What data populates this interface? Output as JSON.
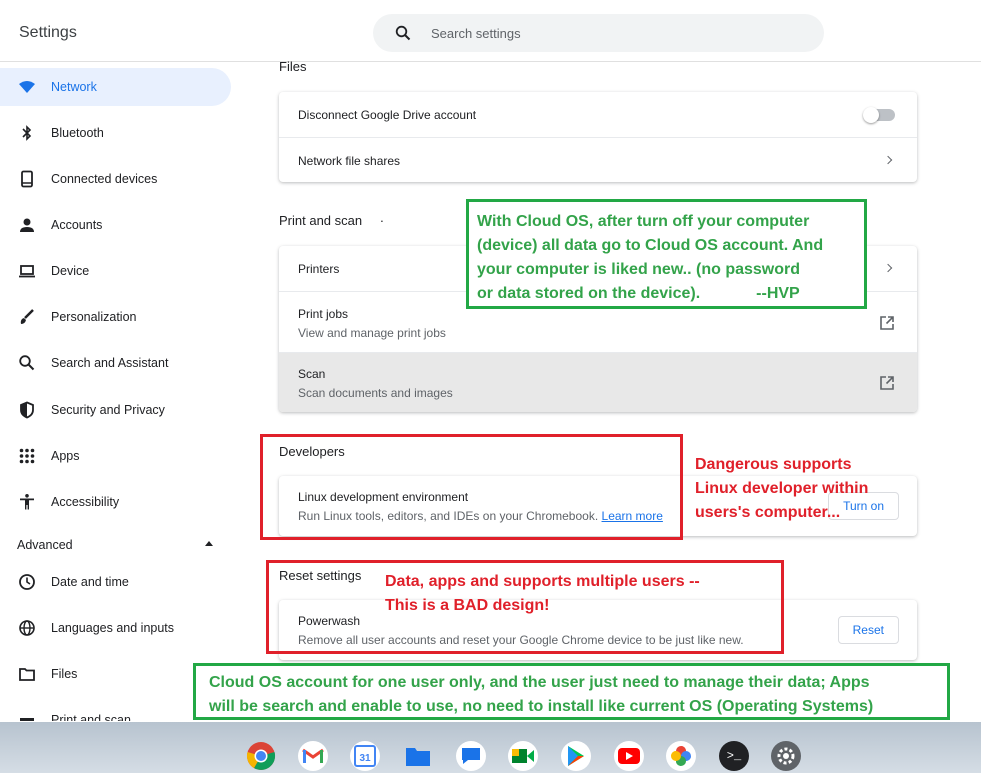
{
  "app": {
    "title": "Settings"
  },
  "search": {
    "placeholder": "Search settings"
  },
  "sidebar": {
    "items": [
      {
        "label": "Network",
        "icon": "wifi-icon",
        "active": true
      },
      {
        "label": "Bluetooth",
        "icon": "bluetooth-icon"
      },
      {
        "label": "Connected devices",
        "icon": "phone-icon"
      },
      {
        "label": "Accounts",
        "icon": "person-icon"
      },
      {
        "label": "Device",
        "icon": "laptop-icon"
      },
      {
        "label": "Personalization",
        "icon": "brush-icon"
      },
      {
        "label": "Search and Assistant",
        "icon": "search-icon"
      },
      {
        "label": "Security and Privacy",
        "icon": "shield-icon"
      },
      {
        "label": "Apps",
        "icon": "grid-icon"
      },
      {
        "label": "Accessibility",
        "icon": "accessibility-icon"
      }
    ],
    "advanced_label": "Advanced",
    "advanced_items": [
      {
        "label": "Date and time",
        "icon": "clock-icon"
      },
      {
        "label": "Languages and inputs",
        "icon": "globe-icon"
      },
      {
        "label": "Files",
        "icon": "folder-icon"
      },
      {
        "label": "Print and scan",
        "icon": "printer-icon"
      }
    ]
  },
  "files": {
    "title": "Files",
    "disconnect_label": "Disconnect Google Drive account",
    "disconnect_enabled": false,
    "network_shares_label": "Network file shares"
  },
  "print_scan": {
    "title": "Print and scan",
    "title_dot": "·",
    "printers_label": "Printers",
    "print_jobs_label": "Print jobs",
    "print_jobs_sub": "View and manage print jobs",
    "scan_label": "Scan",
    "scan_sub": "Scan documents and images"
  },
  "developers": {
    "title": "Developers",
    "linux_label": "Linux development environment",
    "linux_sub": "Run Linux tools, editors, and IDEs on your Chromebook.",
    "learn_more": "Learn more",
    "turn_on_label": "Turn on"
  },
  "reset": {
    "title": "Reset settings",
    "powerwash_label": "Powerwash",
    "powerwash_sub": "Remove all user accounts and reset your Google Chrome device to be just like new.",
    "reset_label": "Reset"
  },
  "annotations": {
    "cloud_os_lines": [
      "With Cloud OS, after turn off your computer",
      "(device) all data go to Cloud OS account. And",
      "your computer is liked new.. (no password",
      "or data stored on the device)."
    ],
    "cloud_os_signature": "--HVP",
    "dangerous_lines": [
      "Dangerous supports",
      "Linux developer within",
      "users's computer..."
    ],
    "bad_design_lines": [
      "Data, apps and supports multiple users --",
      "This is a BAD design!"
    ],
    "one_user_lines": [
      "Cloud OS account for one user only, and the user just need to manage their data; Apps",
      "will be search and enable to use, no need to install like current OS (Operating Systems)"
    ],
    "colors": {
      "green": "#33a34a",
      "red": "#e0202a"
    }
  },
  "shelf": {
    "apps": [
      "chrome-icon",
      "gmail-icon",
      "calendar-icon",
      "files-icon",
      "messages-icon",
      "meet-icon",
      "play-store-icon",
      "youtube-icon",
      "photos-icon",
      "terminal-icon",
      "settings-icon"
    ],
    "calendar_day": "31",
    "terminal_prompt": ">_"
  }
}
